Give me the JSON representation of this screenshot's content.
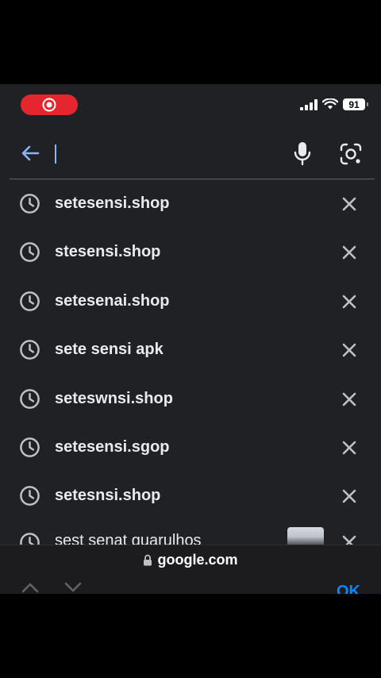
{
  "status_bar": {
    "record_icon": "record-icon",
    "signal_icon": "cellular-signal-icon",
    "wifi_icon": "wifi-icon",
    "battery_level": "91"
  },
  "search": {
    "value": "",
    "back_icon": "arrow-left-icon",
    "mic_icon": "microphone-icon",
    "lens_icon": "camera-lens-icon"
  },
  "suggestions": [
    {
      "label": "setesensi.shop"
    },
    {
      "label": "stesensi.shop"
    },
    {
      "label": "setesenai.shop"
    },
    {
      "label": "sete sensi apk"
    },
    {
      "label": "seteswnsi.shop"
    },
    {
      "label": "setesensi.sgop"
    },
    {
      "label": "setesnsi.shop"
    },
    {
      "label": "sest senat guarulhos"
    }
  ],
  "url_bar": {
    "lock_icon": "lock-icon",
    "domain": "google.com"
  },
  "toolbar": {
    "ok_label": "OK"
  },
  "colors": {
    "background": "#202124",
    "accent": "#8ab4f8",
    "record": "#e5262e",
    "ok": "#0a84ff"
  }
}
